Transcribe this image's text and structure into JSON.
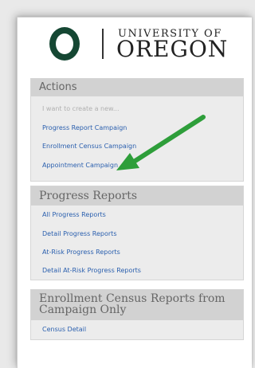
{
  "logo": {
    "line1": "UNIVERSITY OF",
    "line2": "OREGON",
    "brand_color": "#154733"
  },
  "actions": {
    "title": "Actions",
    "hint": "I want to create a new...",
    "items": [
      "Progress Report Campaign",
      "Enrollment Census Campaign",
      "Appointment Campaign"
    ]
  },
  "progress_reports": {
    "title": "Progress Reports",
    "items": [
      "All Progress Reports",
      "Detail Progress Reports",
      "At-Risk Progress Reports",
      "Detail At-Risk Progress Reports"
    ]
  },
  "census": {
    "title_line1": "Enrollment Census Reports from",
    "title_line2": "Campaign Only",
    "items": [
      "Census Detail"
    ]
  },
  "annotation": {
    "arrow_color": "#2e9e3a"
  }
}
